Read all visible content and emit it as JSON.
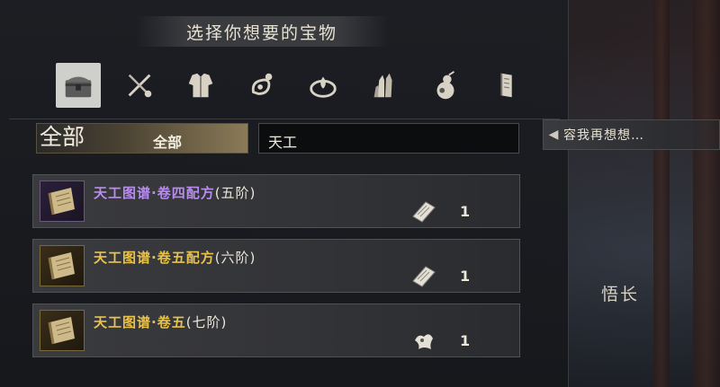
{
  "title": "选择你想要的宝物",
  "tabs": [
    {
      "icon": "treasure-chest-icon",
      "active": true
    },
    {
      "icon": "crossed-weapons-icon",
      "active": false
    },
    {
      "icon": "armor-icon",
      "active": false
    },
    {
      "icon": "accessory-icon",
      "active": false
    },
    {
      "icon": "elixir-icon",
      "active": false
    },
    {
      "icon": "crystal-icon",
      "active": false
    },
    {
      "icon": "gourd-icon",
      "active": false
    },
    {
      "icon": "book-icon",
      "active": false
    }
  ],
  "filter": {
    "category_large": "全部",
    "category_small": "全部",
    "search_value": "天工"
  },
  "items": [
    {
      "name": "天工图谱·卷四配方",
      "grade": "(五阶)",
      "color": "#b98cf0",
      "count": "1",
      "icon": "scroll-icon",
      "count_icon": "paper-icon"
    },
    {
      "name": "天工图谱·卷五配方",
      "grade": "(六阶)",
      "color": "#e8c24a",
      "count": "1",
      "icon": "scroll-icon",
      "count_icon": "paper-icon"
    },
    {
      "name": "天工图谱·卷五",
      "grade": "(七阶)",
      "color": "#e8c24a",
      "count": "1",
      "icon": "scroll-icon",
      "count_icon": "claw-icon"
    }
  ],
  "back_button": {
    "label": "容我再想想…"
  },
  "npc_name": "悟长"
}
